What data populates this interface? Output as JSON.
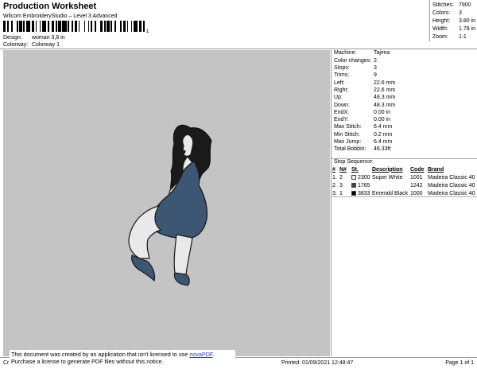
{
  "header": {
    "title": "Production Worksheet",
    "software": "Wilcom EmbroideryStudio – Level 3 Advanced",
    "barcode_number": "1",
    "design_label": "Design:",
    "design_value": "woman 3,8 in",
    "colorway_label": "Colorway:",
    "colorway_value": "Colorway 1"
  },
  "summary": [
    {
      "label": "Stitches:",
      "value": "7900"
    },
    {
      "label": "Colors:",
      "value": "3"
    },
    {
      "label": "Height:",
      "value": "3.80 in"
    },
    {
      "label": "Width:",
      "value": "1.78 in"
    },
    {
      "label": "Zoom:",
      "value": "1:1"
    }
  ],
  "machine_info": [
    {
      "label": "Machine:",
      "value": "Tajima"
    },
    {
      "label": "Color changes:",
      "value": "2"
    },
    {
      "label": "Stops:",
      "value": "3"
    },
    {
      "label": "Trims:",
      "value": "9"
    },
    {
      "label": "Left:",
      "value": "22.6 mm"
    },
    {
      "label": "Right:",
      "value": "22.6 mm"
    },
    {
      "label": "Up:",
      "value": "48.3 mm"
    },
    {
      "label": "Down:",
      "value": "48.3 mm"
    },
    {
      "label": "EndX:",
      "value": "0.00 in"
    },
    {
      "label": "EndY:",
      "value": "0.00 in"
    },
    {
      "label": "Max Stitch:",
      "value": "6.4 mm"
    },
    {
      "label": "Min Stitch:",
      "value": "0.2 mm"
    },
    {
      "label": "Max Jump:",
      "value": "6.4 mm"
    },
    {
      "label": "Total Bobbin:",
      "value": "46.33ft"
    }
  ],
  "stop_sequence": {
    "title": "Stop Sequence:",
    "columns": [
      "#",
      "N#",
      "St.",
      "Description",
      "Code",
      "Brand"
    ],
    "rows": [
      {
        "index": "1.",
        "n": "2",
        "color": "#ececec",
        "stitches": "2300",
        "description": "Super White",
        "code": "1001",
        "brand": "Madeira Classic 40"
      },
      {
        "index": "2.",
        "n": "3",
        "color": "#34495e",
        "stitches": "1765",
        "description": "",
        "code": "1242",
        "brand": "Madeira Classic 40"
      },
      {
        "index": "3.",
        "n": "1",
        "color": "#000000",
        "stitches": "3833",
        "description": "Emerald Black",
        "code": "1000",
        "brand": "Madeira Classic 40"
      }
    ]
  },
  "footer": {
    "left": "Cr",
    "printed": "Printed: 01/09/2021 12:48:47",
    "page": "Page 1 of 1"
  },
  "notice": {
    "line1_prefix": "This document was created by an application that isn't licensed to use ",
    "link": "novaPDF",
    "line1_suffix": ".",
    "line2": "Purchase a license to generate PDF files without this notice."
  },
  "colors": {
    "canvas_bg": "#c4c4c4",
    "hair": "#1a1a1a",
    "skin": "#e9e9e9",
    "dress": "#3d5673",
    "shoe": "#3d5673"
  }
}
